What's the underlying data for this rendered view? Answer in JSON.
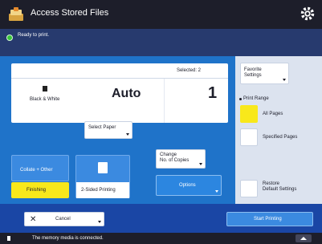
{
  "app": {
    "title": "Access Stored Files",
    "status": "Ready to print.",
    "icons": {
      "app": "stored-files-icon",
      "settings": "gear-icon"
    }
  },
  "summary": {
    "selected": "Selected: 2",
    "color_mode": "Black & White",
    "paper": "Auto",
    "copies": "1"
  },
  "buttons": {
    "select_paper": "Select Paper",
    "change_copies_line1": "Change",
    "change_copies_line2": "No. of Copies",
    "collate": "Collate + Other",
    "finishing": "Finishing",
    "two_sided": "2-Sided Printing",
    "options": "Options"
  },
  "side": {
    "favorite_line1": "Favorite",
    "favorite_line2": "Settings",
    "print_range": "Print Range",
    "all_pages": "All Pages",
    "specified_pages": "Specified Pages",
    "restore_line1": "Restore",
    "restore_line2": "Default Settings"
  },
  "bottom": {
    "cancel": "Cancel",
    "start": "Start Printing"
  },
  "footer": {
    "message": "The memory media is connected."
  },
  "colors": {
    "title_bar": "#1d1e2a",
    "status_bar": "#273a6e",
    "main": "#1f73c9",
    "accent_yellow": "#f8e81b",
    "accent_blue": "#3b8ae0"
  }
}
